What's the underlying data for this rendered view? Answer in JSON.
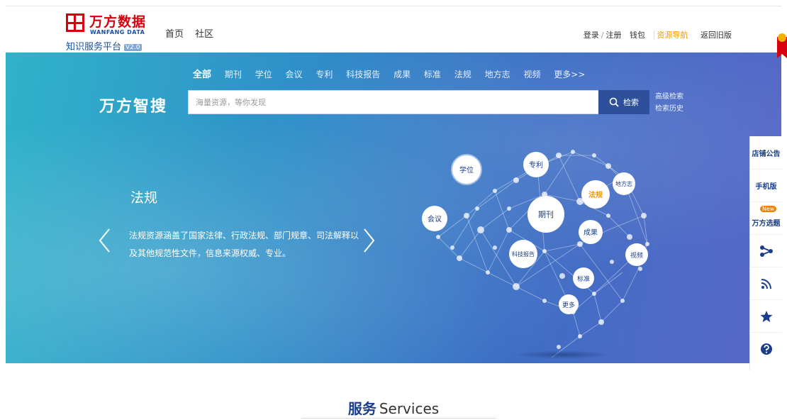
{
  "header": {
    "logo_cn": "万方数据",
    "logo_en": "WANFANG DATA",
    "platform": "知识服务平台",
    "version": "V2.0",
    "nav_left": [
      "首页",
      "社区"
    ],
    "nav_right": {
      "login": "登录",
      "register": "注册",
      "wallet": "钱包",
      "resource_nav": "资源导航",
      "old_version": "返回旧版"
    }
  },
  "search": {
    "categories": [
      "全部",
      "期刊",
      "学位",
      "会议",
      "专利",
      "科技报告",
      "成果",
      "标准",
      "法规",
      "地方志",
      "视频",
      "更多>>"
    ],
    "active_category": "全部",
    "title": "万方智搜",
    "placeholder": "海量资源，等你发现",
    "button": "检索",
    "advanced": "高级检索",
    "history": "检索历史"
  },
  "slide": {
    "title": "法规",
    "description": "法规资源涵盖了国家法律、行政法规、部门规章、司法解释以及其他规范性文件，信息来源权威、专业。",
    "brain_labels": {
      "xuewei": "学位",
      "zhuanli": "专利",
      "difangzhi": "地方志",
      "fagui": "法规",
      "huiyi": "会议",
      "qikan": "期刊",
      "chengguo": "成果",
      "shipin": "视频",
      "kejibaogao": "科技报告",
      "biaozhun": "标准",
      "gengduo": "更多"
    }
  },
  "sidebar": {
    "items": [
      "店铺公告",
      "手机版",
      "万方选题"
    ],
    "new_badge": "New",
    "icons": [
      "share-icon",
      "rss-icon",
      "star-icon",
      "help-icon"
    ]
  },
  "services": {
    "title_cn": "服务",
    "title_en": "Services"
  },
  "colors": {
    "brand_red": "#d6000f",
    "brand_blue": "#1a3e8c",
    "highlight": "#f39800"
  }
}
